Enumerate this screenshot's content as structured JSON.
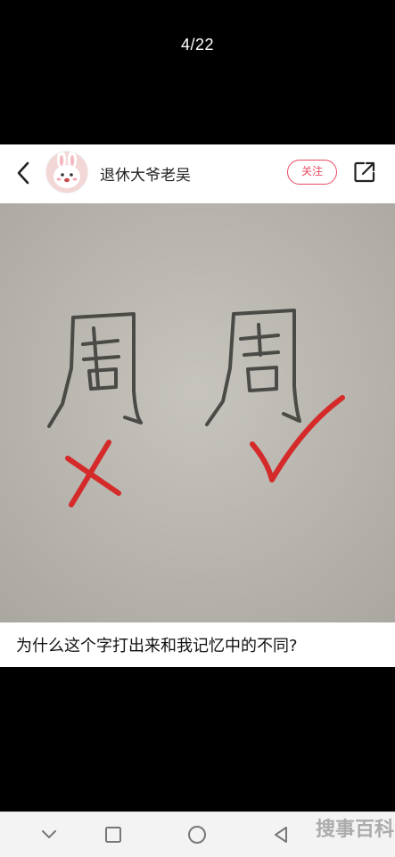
{
  "viewer": {
    "counter": "4/22"
  },
  "post": {
    "author": "退休大爷老吴",
    "follow_label": "关注",
    "caption": "为什么这个字打出来和我记忆中的不同?"
  },
  "photo": {
    "characters": [
      "周",
      "周"
    ],
    "marks": [
      "cross-icon",
      "check-icon"
    ],
    "mark_color": "#d42a2a"
  },
  "watermark": {
    "text": "搜事百科"
  },
  "colors": {
    "accent": "#e84a5f",
    "paper": "#bdbbb3"
  }
}
